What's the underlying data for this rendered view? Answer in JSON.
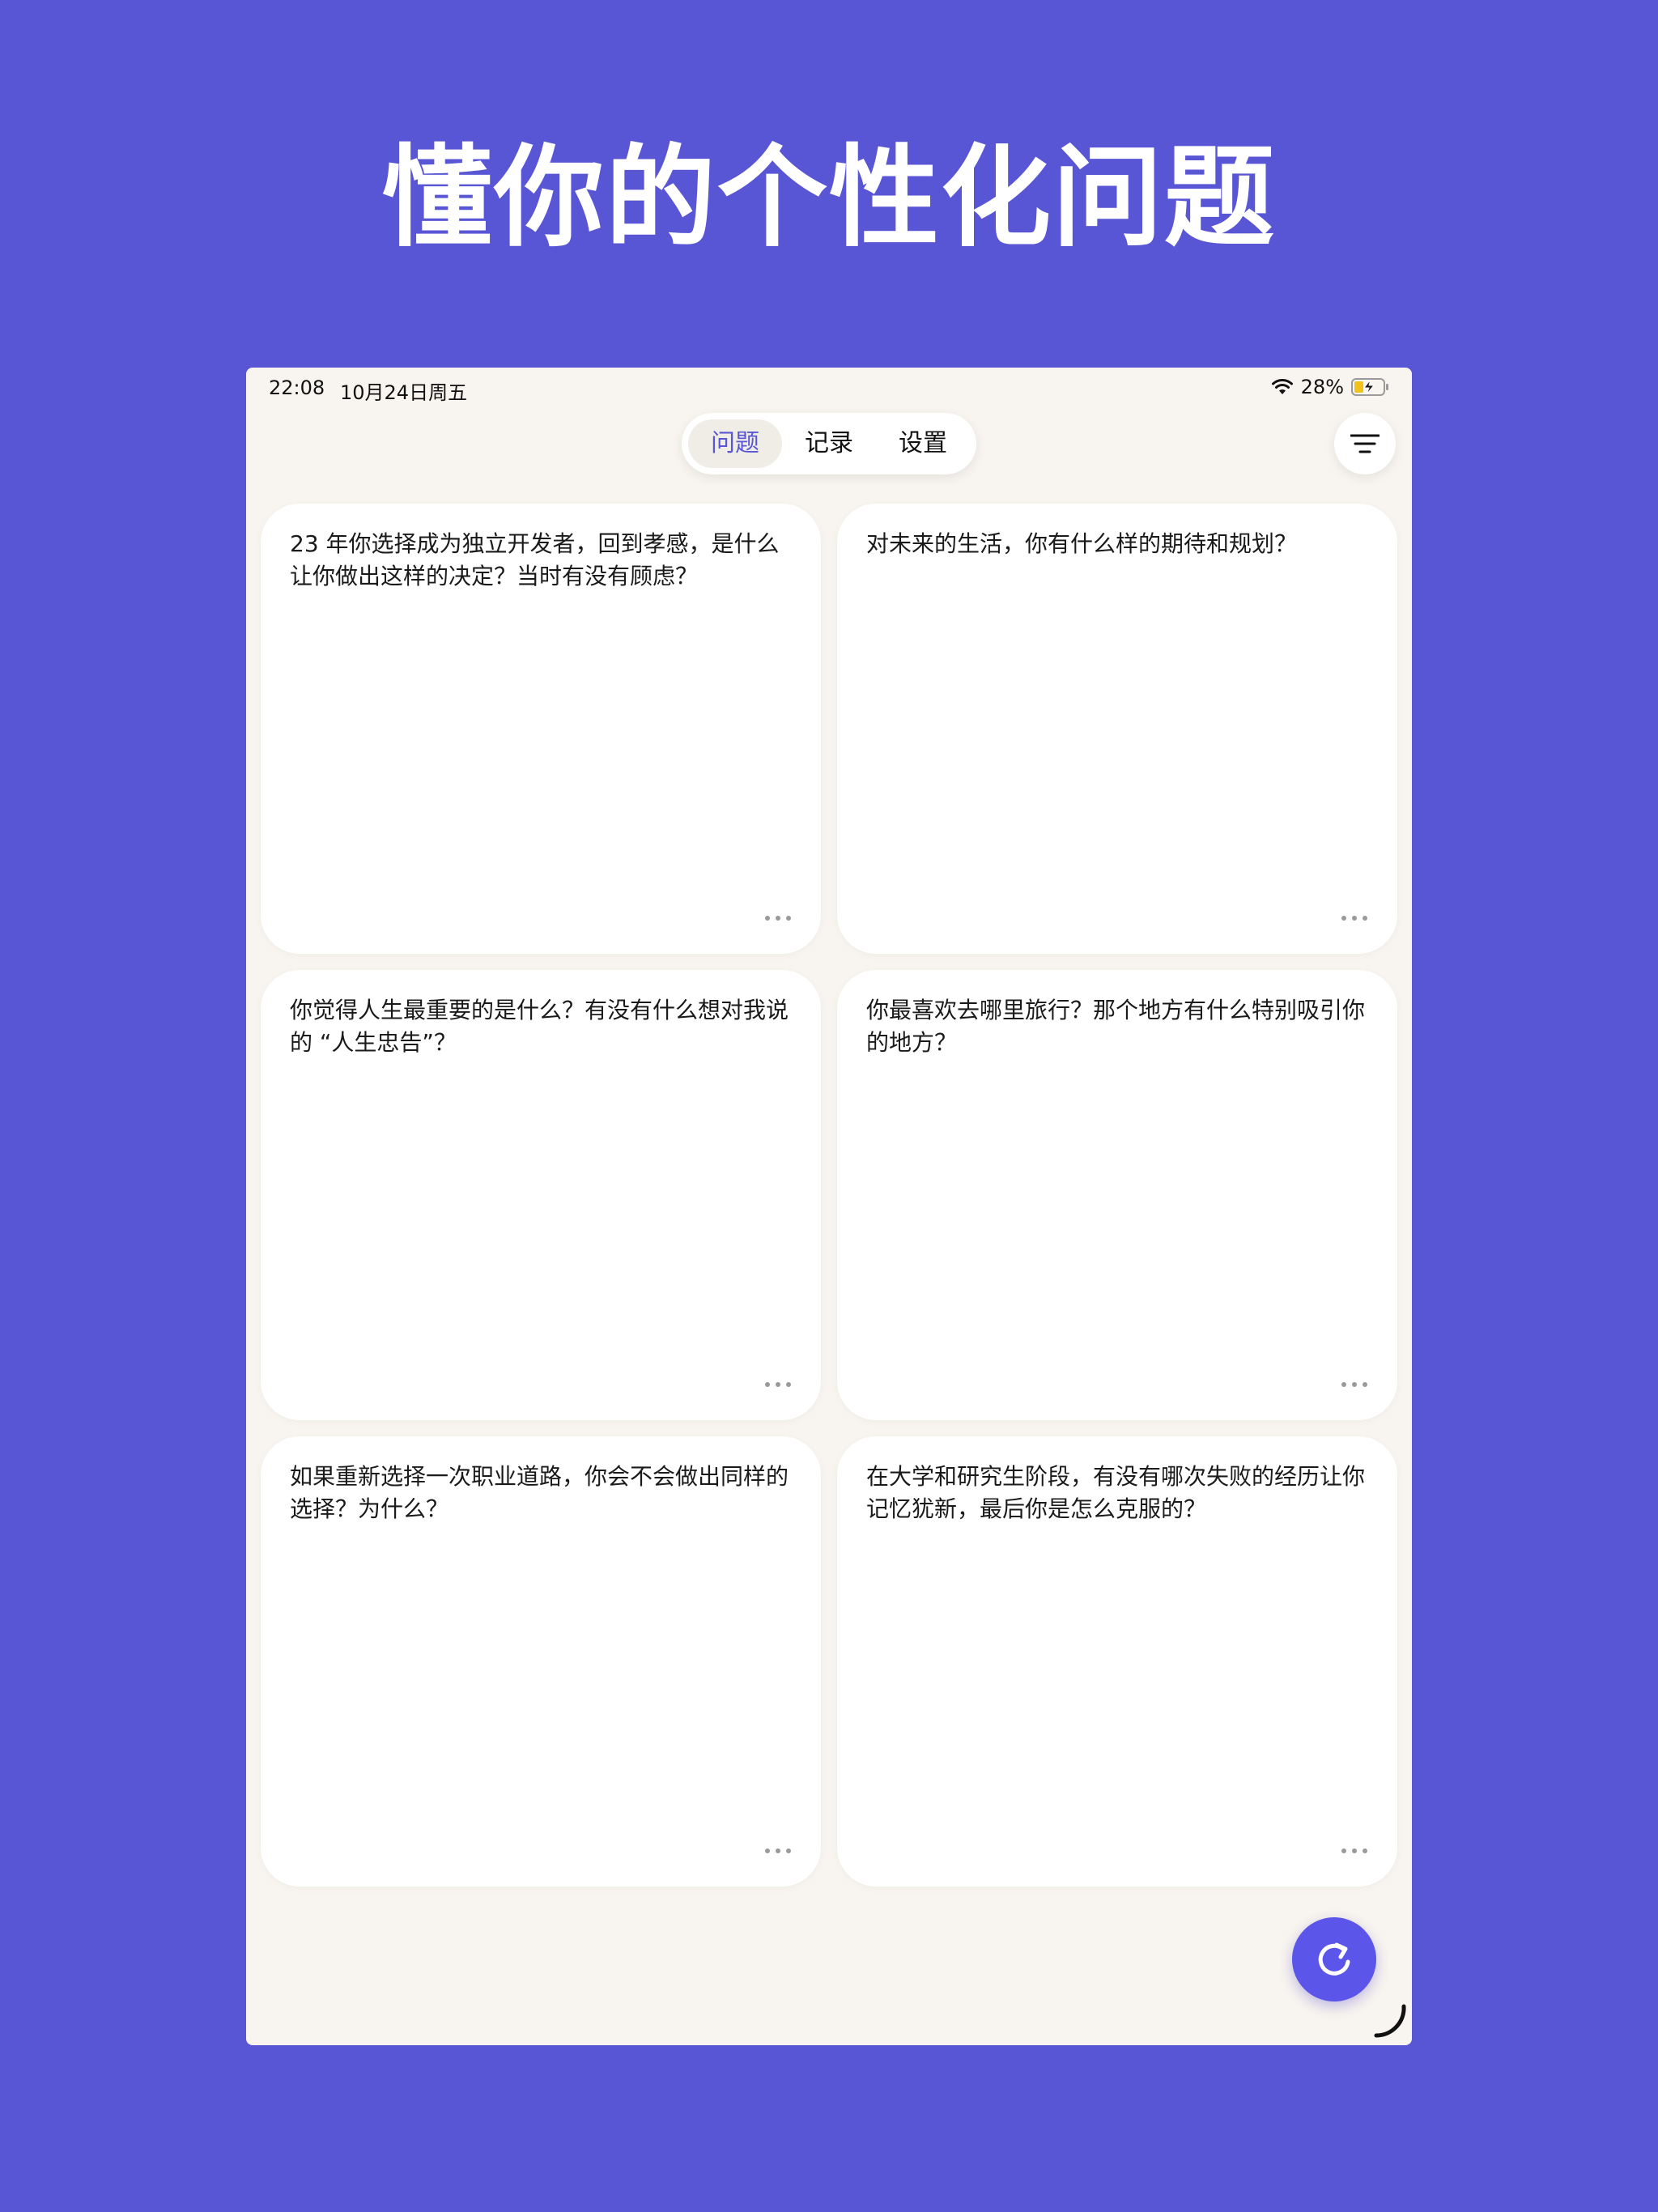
{
  "headline": "懂你的个性化问题",
  "status_bar": {
    "time": "22:08",
    "date": "10月24日周五",
    "battery": "28%"
  },
  "tabs": [
    {
      "label": "问题",
      "active": true
    },
    {
      "label": "记录",
      "active": false
    },
    {
      "label": "设置",
      "active": false
    }
  ],
  "questions": [
    {
      "text": "23 年你选择成为独立开发者，回到孝感，是什么让你做出这样的决定？当时有没有顾虑？"
    },
    {
      "text": "对未来的生活，你有什么样的期待和规划？"
    },
    {
      "text": "你觉得人生最重要的是什么？有没有什么想对我说的 “人生忠告”？"
    },
    {
      "text": "你最喜欢去哪里旅行？那个地方有什么特别吸引你的地方？"
    },
    {
      "text": "如果重新选择一次职业道路，你会不会做出同样的选择？为什么？"
    },
    {
      "text": "在大学和研究生阶段，有没有哪次失败的经历让你记忆犹新，最后你是怎么克服的？"
    }
  ],
  "icons": {
    "filter": "filter-lines-icon",
    "more": "ellipsis-icon",
    "refresh": "refresh-icon",
    "wifi": "wifi-icon",
    "battery": "battery-charging-icon"
  },
  "colors": {
    "background": "#5956d6",
    "accent": "#5c55ea",
    "surface": "#f8f4ef",
    "card": "#ffffff"
  }
}
